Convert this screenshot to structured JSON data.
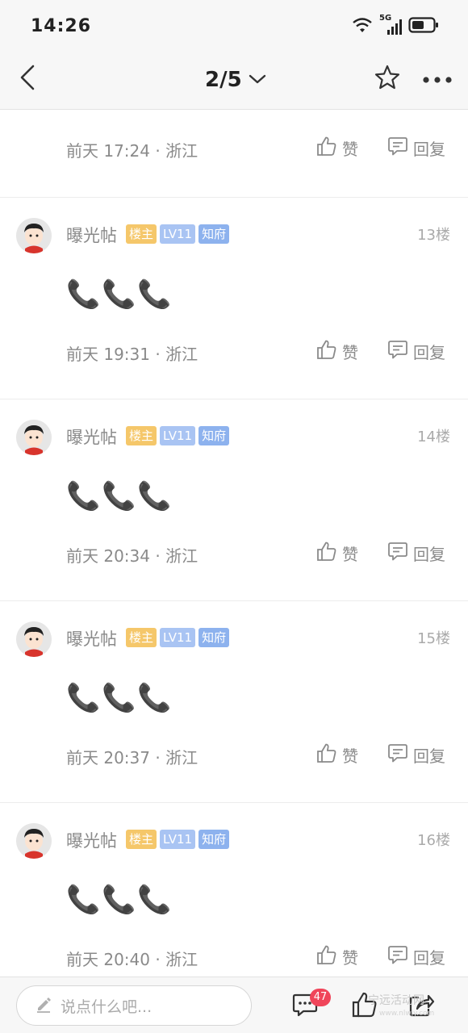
{
  "status_bar": {
    "time": "14:26",
    "network": "5G"
  },
  "nav": {
    "page_indicator": "2/5"
  },
  "top_partial": {
    "time": "前天 17:24 · 浙江",
    "like_label": "赞",
    "reply_label": "回复"
  },
  "floors": [
    {
      "username": "曝光帖",
      "badges": [
        "楼主",
        "LV11",
        "知府"
      ],
      "floor": "13楼",
      "emoji": [
        "📞",
        "📞",
        "📞"
      ],
      "time": "前天 19:31 · 浙江",
      "like_label": "赞",
      "reply_label": "回复"
    },
    {
      "username": "曝光帖",
      "badges": [
        "楼主",
        "LV11",
        "知府"
      ],
      "floor": "14楼",
      "emoji": [
        "📞",
        "📞",
        "📞"
      ],
      "time": "前天 20:34 · 浙江",
      "like_label": "赞",
      "reply_label": "回复"
    },
    {
      "username": "曝光帖",
      "badges": [
        "楼主",
        "LV11",
        "知府"
      ],
      "floor": "15楼",
      "emoji": [
        "📞",
        "📞",
        "📞"
      ],
      "time": "前天 20:37 · 浙江",
      "like_label": "赞",
      "reply_label": "回复"
    },
    {
      "username": "曝光帖",
      "badges": [
        "楼主",
        "LV11",
        "知府"
      ],
      "floor": "16楼",
      "emoji": [
        "📞",
        "📞",
        "📞"
      ],
      "time": "前天 20:40 · 浙江",
      "like_label": "赞",
      "reply_label": "回复"
    }
  ],
  "bottom_bar": {
    "comment_placeholder": "说点什么吧...",
    "comment_count": "47",
    "watermark": "宁远活动网",
    "watermark_url": "www.nlwjy.com"
  },
  "colors": {
    "owner_badge": "#f5c76a",
    "level_badge": "#a9c4f3",
    "title_badge": "#8db2ee",
    "count_badge": "#f0455a"
  },
  "icons": [
    "back-icon",
    "chevron-down-icon",
    "star-icon",
    "more-icon",
    "thumb-up-icon",
    "reply-icon",
    "pencil-icon",
    "comment-icon",
    "share-icon",
    "wifi-icon",
    "signal-icon",
    "battery-icon"
  ]
}
